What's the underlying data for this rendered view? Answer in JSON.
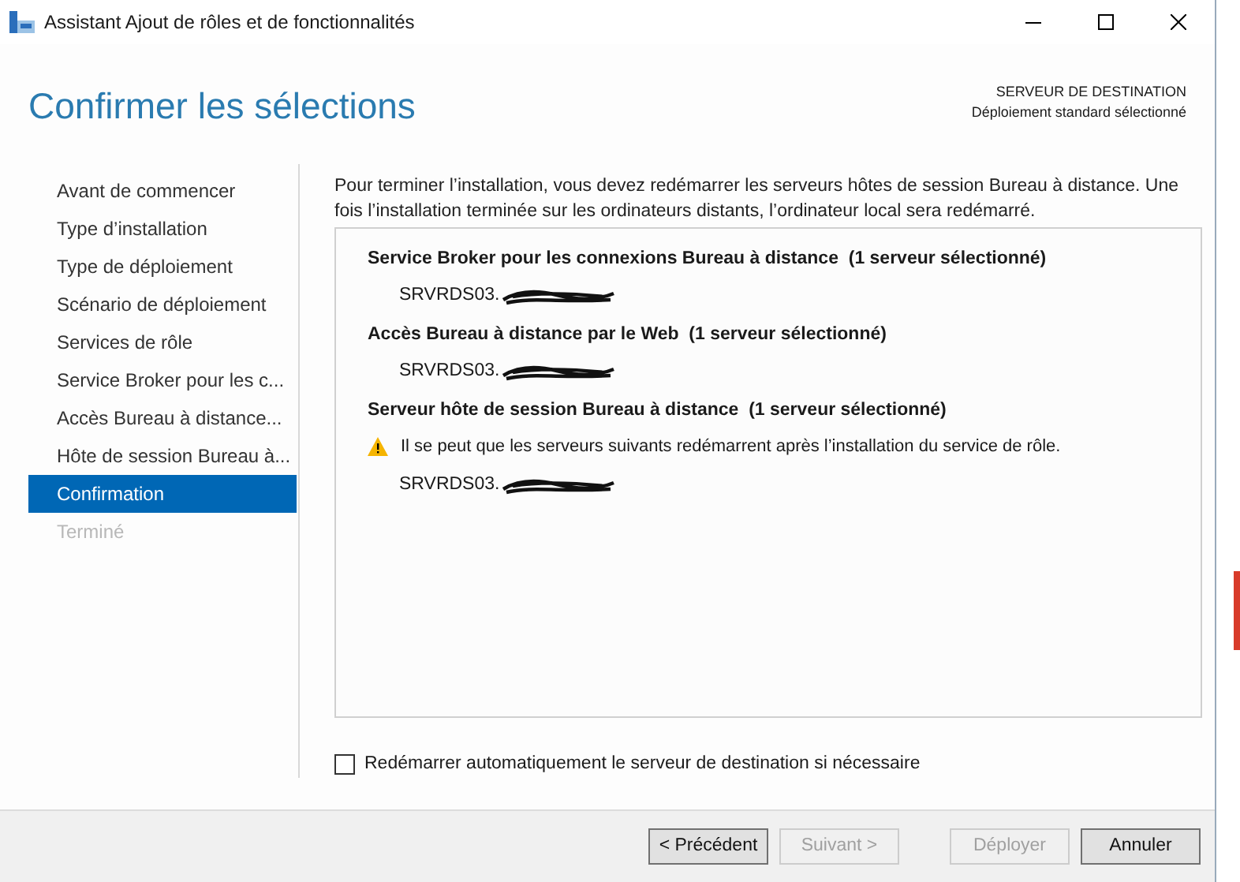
{
  "window": {
    "title": "Assistant Ajout de rôles et de fonctionnalités"
  },
  "header": {
    "title": "Confirmer les sélections",
    "destination_label": "SERVEUR DE DESTINATION",
    "destination_value": "Déploiement standard sélectionné"
  },
  "sidebar": {
    "items": [
      {
        "label": "Avant de commencer",
        "selected": false,
        "disabled": false
      },
      {
        "label": "Type d’installation",
        "selected": false,
        "disabled": false
      },
      {
        "label": "Type de déploiement",
        "selected": false,
        "disabled": false
      },
      {
        "label": "Scénario de déploiement",
        "selected": false,
        "disabled": false
      },
      {
        "label": "Services de rôle",
        "selected": false,
        "disabled": false
      },
      {
        "label": "Service Broker pour les c...",
        "selected": false,
        "disabled": false
      },
      {
        "label": "Accès Bureau à distance...",
        "selected": false,
        "disabled": false
      },
      {
        "label": "Hôte de session Bureau à...",
        "selected": false,
        "disabled": false
      },
      {
        "label": "Confirmation",
        "selected": true,
        "disabled": false
      },
      {
        "label": "Terminé",
        "selected": false,
        "disabled": true
      }
    ]
  },
  "intro": "Pour terminer l’installation, vous devez redémarrer les serveurs hôtes de session Bureau à distance. Une fois l’installation terminée sur les ordinateurs distants, l’ordinateur local sera redémarré.",
  "sections": [
    {
      "heading": "Service Broker pour les connexions Bureau à distance  (1 serveur sélectionné)",
      "servers": [
        "SRVRDS03."
      ]
    },
    {
      "heading": "Accès Bureau à distance par le Web  (1 serveur sélectionné)",
      "servers": [
        "SRVRDS03."
      ]
    },
    {
      "heading": "Serveur hôte de session Bureau à distance  (1 serveur sélectionné)",
      "warning": "Il se peut que les serveurs suivants redémarrent après l’installation du service de rôle.",
      "servers": [
        "SRVRDS03."
      ]
    }
  ],
  "restart_option": {
    "label": "Redémarrer automatiquement le serveur de destination si nécessaire",
    "checked": false
  },
  "buttons": [
    {
      "label": "< Précédent",
      "disabled": false
    },
    {
      "label": "Suivant >",
      "disabled": true
    },
    {
      "label": "Déployer",
      "disabled": true
    },
    {
      "label": "Annuler",
      "disabled": false
    }
  ]
}
